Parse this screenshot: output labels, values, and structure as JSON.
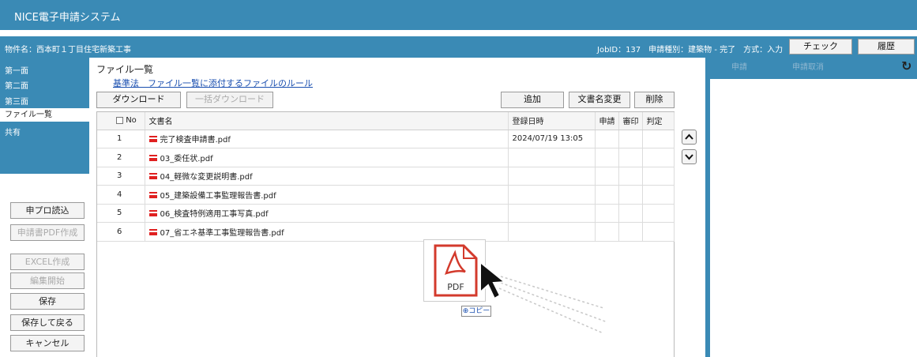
{
  "app": {
    "title": "NICE電子申請システム"
  },
  "infobar": {
    "property": "物件名：西本町１丁目住宅新築工事",
    "job": "JobID：137　申請種別：建築物 - 完了　方式：入力",
    "check_label": "チェック",
    "history_label": "履歴"
  },
  "sidenav": {
    "items": [
      {
        "label": "第一面"
      },
      {
        "label": "第二面"
      },
      {
        "label": "第三面"
      },
      {
        "label": "ファイル一覧"
      },
      {
        "label": "共有"
      }
    ]
  },
  "leftbuttons": {
    "read_label": "申プロ読込",
    "pdf_label": "申請書PDF作成",
    "excel_label": "EXCEL作成",
    "edit_label": "編集開始",
    "save_label": "保存",
    "save_back_label": "保存して戻る",
    "cancel_label": "キャンセル"
  },
  "main": {
    "heading": "ファイル一覧",
    "rule_link": "基準法　ファイル一覧に添付するファイルのルール",
    "download_label": "ダウンロード",
    "bulk_download_label": "一括ダウンロード",
    "add_label": "追加",
    "rename_label": "文書名変更",
    "delete_label": "削除"
  },
  "table": {
    "headers": {
      "no": "No",
      "name": "文書名",
      "date": "登録日時",
      "apply": "申請",
      "seal": "審印",
      "judge": "判定"
    },
    "rows": [
      {
        "no": "1",
        "name": "完了検査申請書.pdf",
        "date": "2024/07/19 13:05"
      },
      {
        "no": "2",
        "name": "03_委任状.pdf",
        "date": ""
      },
      {
        "no": "3",
        "name": "04_軽微な変更説明書.pdf",
        "date": ""
      },
      {
        "no": "4",
        "name": "05_建築設備工事監理報告書.pdf",
        "date": ""
      },
      {
        "no": "5",
        "name": "06_検査特例適用工事写真.pdf",
        "date": ""
      },
      {
        "no": "6",
        "name": "07_省エネ基準工事監理報告書.pdf",
        "date": ""
      }
    ]
  },
  "rightpanel": {
    "apply_label": "申請",
    "cancel_apply_label": "申請取消",
    "refresh_icon": "↻"
  },
  "drag": {
    "pdf_label": "PDF",
    "copy_label": "⊕コピー"
  },
  "colors": {
    "header_blue": "#3a8ab5",
    "pdf_red": "#e02020",
    "link_blue": "#1a4fb0"
  }
}
